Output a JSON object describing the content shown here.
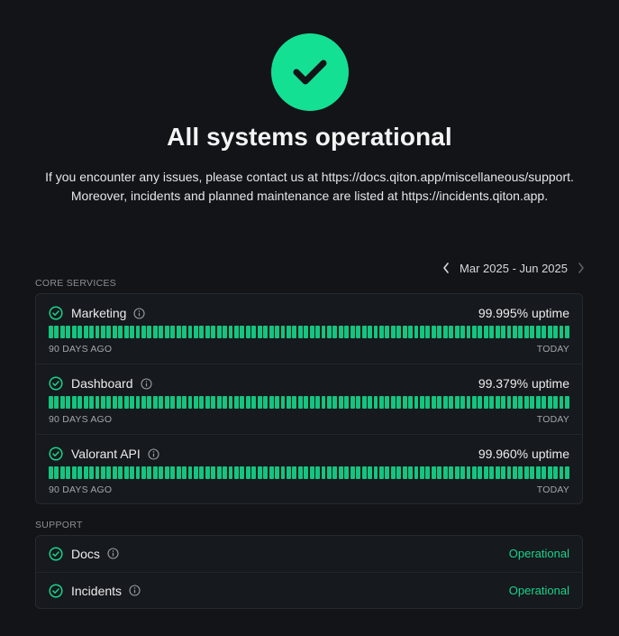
{
  "hero": {
    "icon": "check-icon",
    "title": "All systems operational",
    "desc_line1": "If you encounter any issues, please contact us at https://docs.qiton.app/miscellaneous/support.",
    "desc_line2": "Moreover, incidents and planned maintenance are listed at https://incidents.qiton.app."
  },
  "range": {
    "label": "Mar 2025 - Jun 2025"
  },
  "sections": {
    "core": {
      "label": "CORE SERVICES",
      "services": [
        {
          "name": "Marketing",
          "uptime": "99.995% uptime",
          "start_label": "90 DAYS AGO",
          "end_label": "TODAY"
        },
        {
          "name": "Dashboard",
          "uptime": "99.379% uptime",
          "start_label": "90 DAYS AGO",
          "end_label": "TODAY"
        },
        {
          "name": "Valorant API",
          "uptime": "99.960% uptime",
          "start_label": "90 DAYS AGO",
          "end_label": "TODAY"
        }
      ]
    },
    "support": {
      "label": "SUPPORT",
      "services": [
        {
          "name": "Docs",
          "status": "Operational"
        },
        {
          "name": "Incidents",
          "status": "Operational"
        }
      ]
    }
  },
  "colors": {
    "background": "#121417",
    "operational": "#14e093",
    "bar": "#14c47f"
  }
}
